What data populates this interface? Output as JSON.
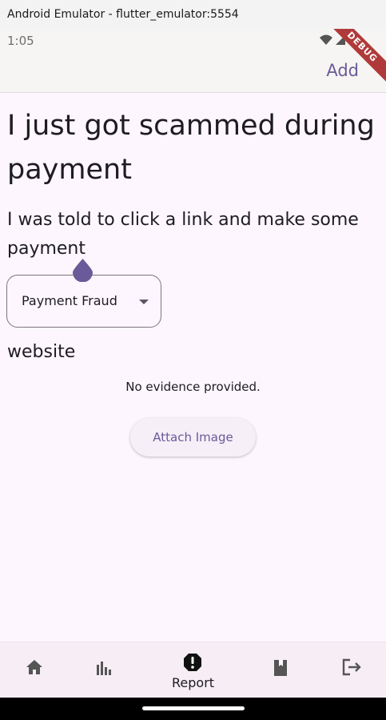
{
  "window": {
    "title": "Android Emulator - flutter_emulator:5554"
  },
  "statusbar": {
    "time": "1:05"
  },
  "appbar": {
    "action_label": "Add",
    "debug_label": "DEBUG"
  },
  "report": {
    "title": "I just got scammed during payment",
    "description": "I was told to click a link and make some payment",
    "category": {
      "selected": "Payment Fraud"
    },
    "source": "website",
    "evidence_status": "No evidence provided.",
    "attach_label": "Attach Image"
  },
  "bottom_nav": {
    "items": [
      {
        "icon": "home-icon"
      },
      {
        "icon": "bar-chart-icon"
      },
      {
        "icon": "report-icon",
        "label": "Report",
        "active": true
      },
      {
        "icon": "book-icon"
      },
      {
        "icon": "logout-icon"
      }
    ]
  },
  "colors": {
    "accent": "#6b5a99",
    "background": "#fdf6fe",
    "nav_background": "#f6edf5",
    "debug_banner": "#b03a3a"
  }
}
